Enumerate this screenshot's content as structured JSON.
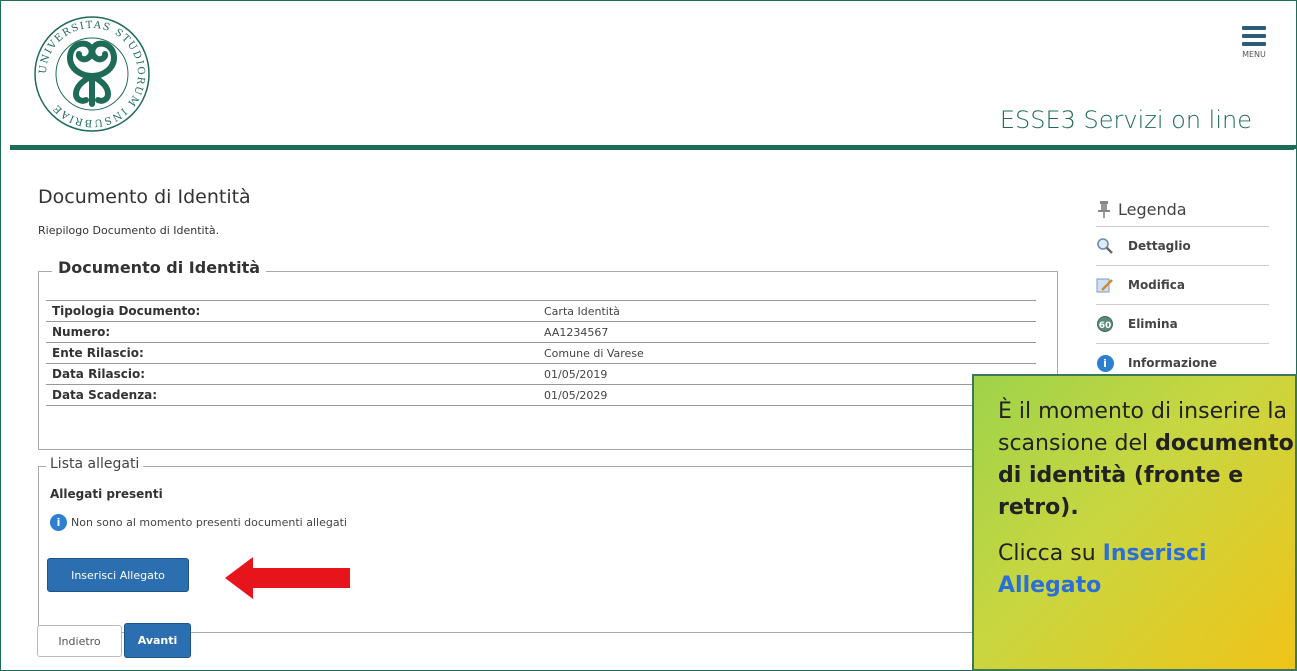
{
  "header": {
    "brand": "ESSE3 Servizi on line",
    "menu_label": "MENU",
    "logo_text": "UNIVERSITAS STUDIORUM INSUBRIAE"
  },
  "page": {
    "title": "Documento di Identità",
    "subtitle": "Riepilogo Documento di Identità."
  },
  "document_box": {
    "legend": "Documento di Identità",
    "rows": [
      {
        "label": "Tipologia Documento:",
        "value": "Carta Identità"
      },
      {
        "label": "Numero:",
        "value": "AA1234567"
      },
      {
        "label": "Ente Rilascio:",
        "value": "Comune di Varese"
      },
      {
        "label": "Data Rilascio:",
        "value": "01/05/2019"
      },
      {
        "label": "Data Scadenza:",
        "value": "01/05/2029"
      }
    ]
  },
  "attachments": {
    "legend": "Lista allegati",
    "title": "Allegati presenti",
    "info": "Non sono al momento presenti documenti allegati",
    "insert_button": "Inserisci Allegato"
  },
  "nav": {
    "back": "Indietro",
    "next": "Avanti"
  },
  "legend_panel": {
    "title": "Legenda",
    "items": [
      {
        "label": "Dettaglio",
        "icon": "magnifier-icon"
      },
      {
        "label": "Modifica",
        "icon": "edit-icon"
      },
      {
        "label": "Elimina",
        "icon": "delete-icon"
      },
      {
        "label": "Informazione",
        "icon": "info-icon"
      }
    ]
  },
  "callout": {
    "line1_a": "È il momento di inserire la scansione del ",
    "line1_b": "documento di identità (fronte e retro)",
    "line1_c": ".",
    "line2_a": "Clicca su ",
    "line2_b": "Inserisci Allegato"
  },
  "colors": {
    "brand_green": "#1e6b58",
    "button_blue": "#2c6fb0",
    "arrow_red": "#e8141b"
  }
}
